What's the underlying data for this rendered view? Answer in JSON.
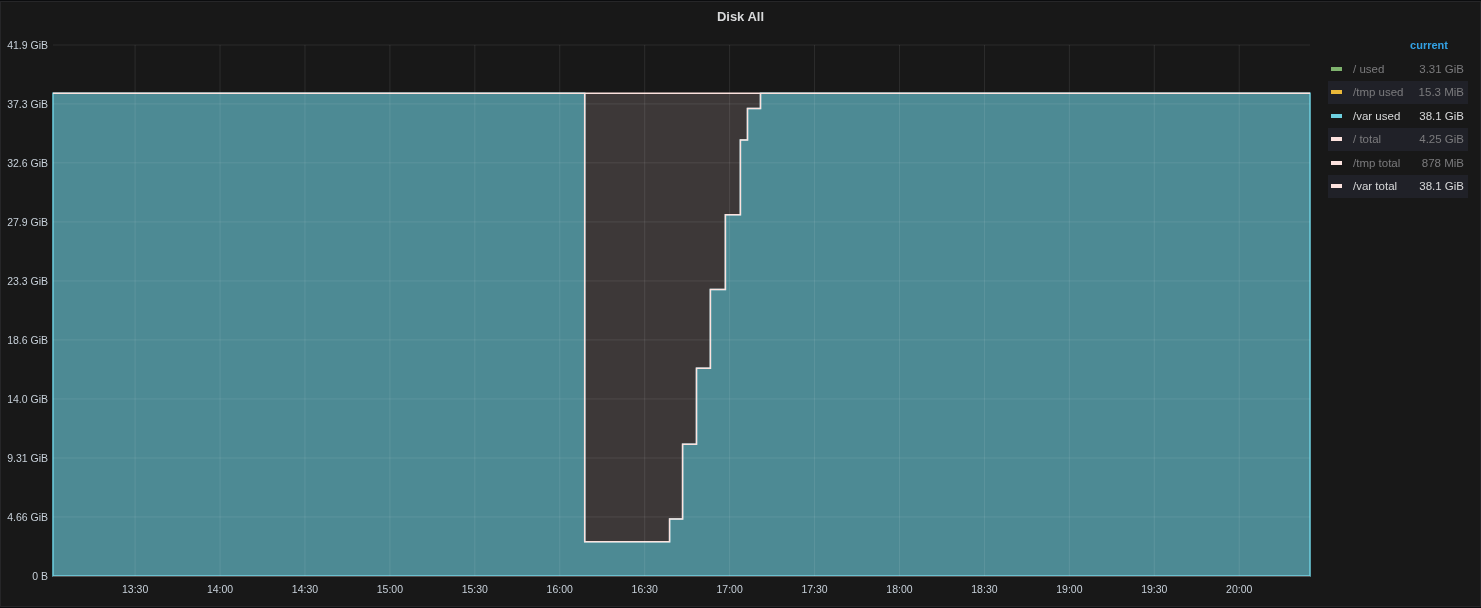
{
  "panel": {
    "title": "Disk All"
  },
  "chart_data": {
    "type": "area",
    "grid": true,
    "xlim": [
      781,
      1225
    ],
    "ylim": [
      0,
      41.9
    ],
    "x": [
      781,
      968.8,
      968.8,
      998.8,
      998.8,
      1003.4,
      1003.4,
      1008.3,
      1008.3,
      1013.2,
      1013.2,
      1018.5,
      1018.5,
      1023.8,
      1023.8,
      1026.3,
      1026.3,
      1030.9,
      1030.9,
      1225
    ],
    "series": [
      {
        "name": "/var used",
        "color": "#6ed0e0",
        "values": [
          38.1,
          38.1,
          2.7,
          2.7,
          4.5,
          4.5,
          10.4,
          10.4,
          16.4,
          16.4,
          22.6,
          22.6,
          28.5,
          28.5,
          34.4,
          34.4,
          36.9,
          36.9,
          38.1,
          38.1
        ]
      },
      {
        "name": "/var total",
        "color": "#fce2de",
        "values": [
          38.1,
          38.1,
          38.1,
          38.1,
          38.1,
          38.1,
          38.1,
          38.1,
          38.1,
          38.1,
          38.1,
          38.1,
          38.1,
          38.1,
          38.1,
          38.1,
          38.1,
          38.1,
          38.1,
          38.1
        ]
      }
    ],
    "xticks": [
      {
        "value": 810,
        "label": "13:30"
      },
      {
        "value": 840,
        "label": "14:00"
      },
      {
        "value": 870,
        "label": "14:30"
      },
      {
        "value": 900,
        "label": "15:00"
      },
      {
        "value": 930,
        "label": "15:30"
      },
      {
        "value": 960,
        "label": "16:00"
      },
      {
        "value": 990,
        "label": "16:30"
      },
      {
        "value": 1020,
        "label": "17:00"
      },
      {
        "value": 1050,
        "label": "17:30"
      },
      {
        "value": 1080,
        "label": "18:00"
      },
      {
        "value": 1110,
        "label": "18:30"
      },
      {
        "value": 1140,
        "label": "19:00"
      },
      {
        "value": 1170,
        "label": "19:30"
      },
      {
        "value": 1200,
        "label": "20:00"
      }
    ],
    "yticks": [
      {
        "value": 0,
        "label": "0 B"
      },
      {
        "value": 4.66,
        "label": "4.66 GiB"
      },
      {
        "value": 9.31,
        "label": "9.31 GiB"
      },
      {
        "value": 13.97,
        "label": "14.0 GiB"
      },
      {
        "value": 18.63,
        "label": "18.6 GiB"
      },
      {
        "value": 23.28,
        "label": "23.3 GiB"
      },
      {
        "value": 27.94,
        "label": "27.9 GiB"
      },
      {
        "value": 32.6,
        "label": "32.6 GiB"
      },
      {
        "value": 37.25,
        "label": "37.3 GiB"
      },
      {
        "value": 41.9,
        "label": "41.9 GiB"
      }
    ]
  },
  "legend": {
    "header": "current",
    "items": [
      {
        "kind": "plain",
        "label": "/ used",
        "value": "3.31 GiB",
        "color": "#7eb26d",
        "hidden": true
      },
      {
        "kind": "plain",
        "label": "/tmp used",
        "value": "15.3 MiB",
        "color": "#eab839",
        "hidden": true
      },
      {
        "kind": "series",
        "value": "38.1 GiB",
        "hidden": false
      },
      {
        "kind": "plain",
        "label": "/ total",
        "value": "4.25 GiB",
        "color": "#fce2de",
        "hidden": true
      },
      {
        "kind": "plain",
        "label": "/tmp total",
        "value": "878 MiB",
        "color": "#fce2de",
        "hidden": true
      },
      {
        "kind": "series",
        "value": "38.1 GiB",
        "hidden": false
      }
    ]
  }
}
